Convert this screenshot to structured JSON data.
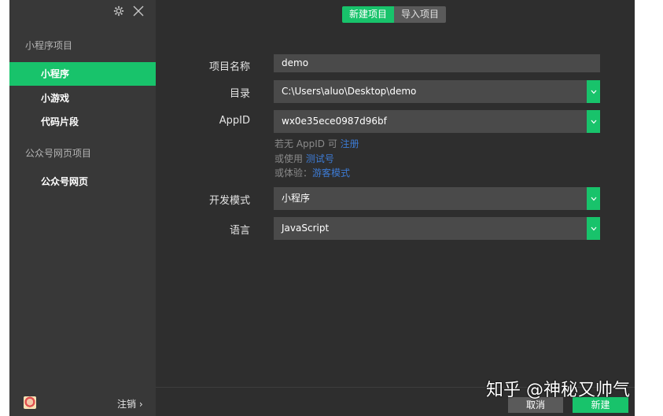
{
  "sidebar": {
    "section_miniprogram": "小程序项目",
    "items": [
      {
        "label": "小程序"
      },
      {
        "label": "小游戏"
      },
      {
        "label": "代码片段"
      }
    ],
    "section_official": "公众号网页项目",
    "official_item": "公众号网页",
    "logout": "注销 ›",
    "accent_color": "#18c36b"
  },
  "tabs": {
    "new": "新建项目",
    "import": "导入项目"
  },
  "form": {
    "name_label": "项目名称",
    "name_value": "demo",
    "dir_label": "目录",
    "dir_value": "C:\\Users\\aluo\\Desktop\\demo",
    "appid_label": "AppID",
    "appid_value": "wx0e35ece0987d96bf",
    "hint1_text": "若无 AppID 可 ",
    "hint1_link": "注册",
    "hint2_text": "或使用 ",
    "hint2_link": "测试号",
    "hint3_text": "或体验：",
    "hint3_link": "游客模式",
    "mode_label": "开发模式",
    "mode_value": "小程序",
    "lang_label": "语言",
    "lang_value": "JavaScript"
  },
  "buttons": {
    "cancel": "取消",
    "create": "新建"
  },
  "watermark": "知乎 @神秘又帅气"
}
